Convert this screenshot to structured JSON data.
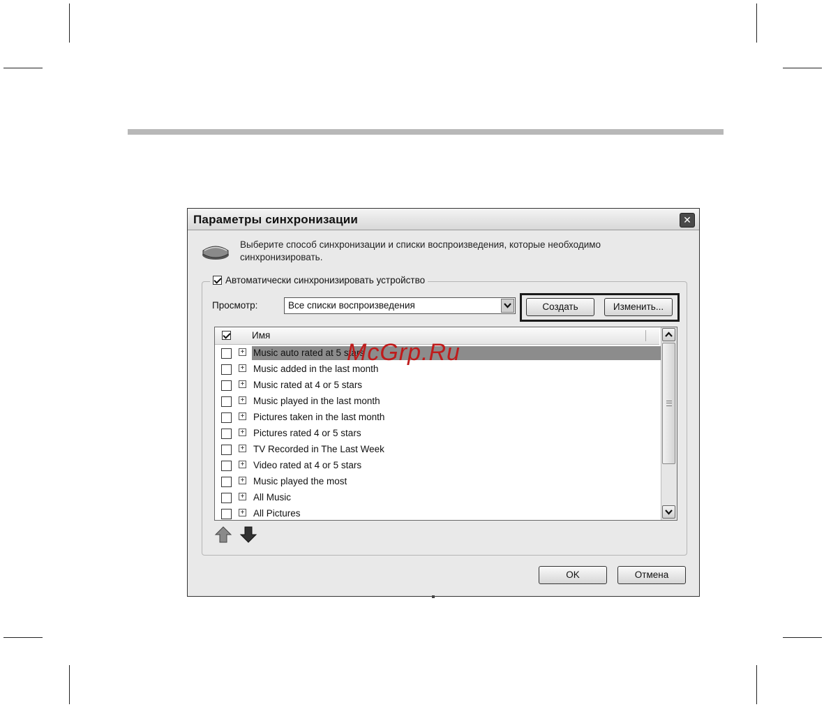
{
  "dialog": {
    "title": "Параметры синхронизации",
    "close_glyph": "✕",
    "description": "Выберите способ синхронизации и списки воспроизведения, которые необходимо синхронизировать.",
    "auto_sync": {
      "label": "Автоматически синхронизировать устройство",
      "checked": true
    },
    "view": {
      "label": "Просмотр:",
      "selected": "Все списки воспроизведения"
    },
    "buttons": {
      "create": "Создать",
      "edit": "Изменить...",
      "ok": "OK",
      "cancel": "Отмена"
    },
    "list": {
      "header": {
        "name": "Имя",
        "checked": true
      },
      "items": [
        {
          "label": "Music auto rated at 5 stars",
          "checked": false,
          "selected": true
        },
        {
          "label": "Music added in the last month",
          "checked": false,
          "selected": false
        },
        {
          "label": "Music rated at 4 or 5 stars",
          "checked": false,
          "selected": false
        },
        {
          "label": "Music played in the last month",
          "checked": false,
          "selected": false
        },
        {
          "label": "Pictures taken in the last month",
          "checked": false,
          "selected": false
        },
        {
          "label": "Pictures rated 4 or 5 stars",
          "checked": false,
          "selected": false
        },
        {
          "label": "TV Recorded in The Last Week",
          "checked": false,
          "selected": false
        },
        {
          "label": "Video rated at 4 or 5 stars",
          "checked": false,
          "selected": false
        },
        {
          "label": "Music played the most",
          "checked": false,
          "selected": false
        },
        {
          "label": "All Music",
          "checked": false,
          "selected": false
        },
        {
          "label": "All Pictures",
          "checked": false,
          "selected": false
        }
      ],
      "expander_glyph": "+"
    }
  },
  "watermark": "McGrp.Ru",
  "colors": {
    "dialog_bg": "#e9e9e9",
    "selection": "#8c8c8c",
    "highlight_frame": "#1a1a1a",
    "watermark": "#bf1b1b"
  }
}
